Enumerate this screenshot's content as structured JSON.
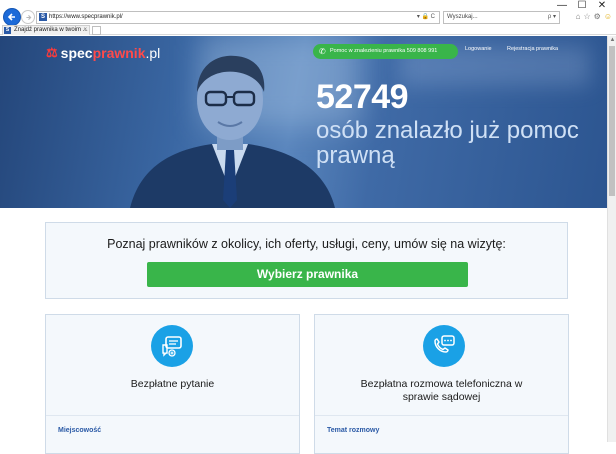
{
  "browser": {
    "url_scheme": "https://www.",
    "url_host": "specprawnik.pl/",
    "url_tools": "▾ 🔒 C",
    "search_placeholder": "Wyszukaj...",
    "search_tools": "ρ ▾",
    "tab_title": "Znajdź prawnika w twoim ...",
    "tab_close": "×",
    "favicon_letter": "S",
    "win_minimize": "—",
    "win_maximize": "☐",
    "win_close": "✕"
  },
  "header": {
    "logo_brand_prefix": "spec",
    "logo_brand": "prawnik",
    "logo_tld": ".pl",
    "hotline_label": "Pomoc w znalezieniu prawnika 509 808 991",
    "login_label": "Logowanie",
    "register_label": "Rejestracja prawnika"
  },
  "hero": {
    "count": "52749",
    "tagline": "osób znalazło już pomoc prawną"
  },
  "finder": {
    "prompt": "Poznaj prawników z okolicy, ich oferty, usługi, ceny, umów się na wizytę:",
    "button_label": "Wybierz prawnika"
  },
  "cards": [
    {
      "title": "Bezpłatne pytanie",
      "field_label": "Miejscowość",
      "icon": "chat-bubbles-icon"
    },
    {
      "title": "Bezpłatna rozmowa telefoniczna w sprawie sądowej",
      "field_label": "Temat rozmowy",
      "icon": "phone-chat-icon"
    }
  ],
  "colors": {
    "brand_red": "#ff4a4a",
    "accent_green": "#39b54a",
    "hero_blue": "#3a67a3",
    "icon_blue": "#1aa1e6",
    "field_label_blue": "#2b5aa6"
  }
}
